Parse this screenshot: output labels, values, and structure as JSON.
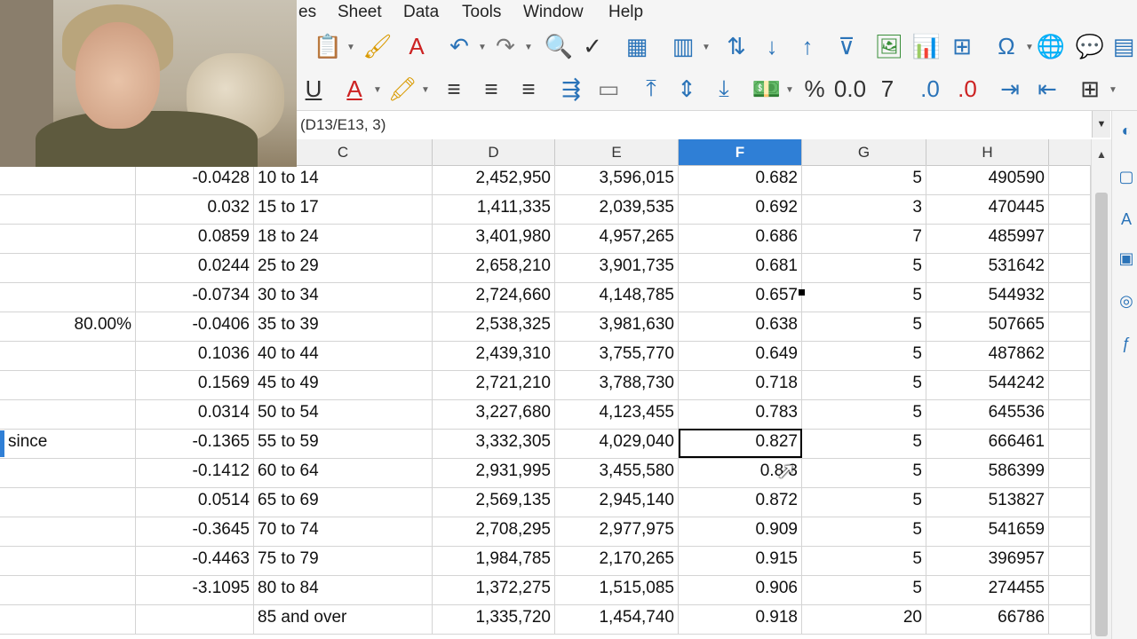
{
  "menu": {
    "items": [
      "es",
      "Sheet",
      "Data",
      "Tools",
      "Window",
      "Help"
    ]
  },
  "formula_bar": {
    "text": "(D13/E13, 3)"
  },
  "columns": [
    "C",
    "D",
    "E",
    "F",
    "G",
    "H"
  ],
  "selected_column": "F",
  "rows": [
    {
      "A": "",
      "B": "-0.0428",
      "C": "10 to 14",
      "D": "2,452,950",
      "E": "3,596,015",
      "F": "0.682",
      "G": "5",
      "H": "490590"
    },
    {
      "A": "",
      "B": "0.032",
      "C": "15 to 17",
      "D": "1,411,335",
      "E": "2,039,535",
      "F": "0.692",
      "G": "3",
      "H": "470445"
    },
    {
      "A": "",
      "B": "0.0859",
      "C": "18 to 24",
      "D": "3,401,980",
      "E": "4,957,265",
      "F": "0.686",
      "G": "7",
      "H": "485997"
    },
    {
      "A": "",
      "B": "0.0244",
      "C": "25 to 29",
      "D": "2,658,210",
      "E": "3,901,735",
      "F": "0.681",
      "G": "5",
      "H": "531642"
    },
    {
      "A": "",
      "B": "-0.0734",
      "C": "30 to 34",
      "D": "2,724,660",
      "E": "4,148,785",
      "F": "0.657",
      "G": "5",
      "H": "544932"
    },
    {
      "A": "80.00%",
      "B": "-0.0406",
      "C": "35 to 39",
      "D": "2,538,325",
      "E": "3,981,630",
      "F": "0.638",
      "G": "5",
      "H": "507665"
    },
    {
      "A": "",
      "B": "0.1036",
      "C": "40 to 44",
      "D": "2,439,310",
      "E": "3,755,770",
      "F": "0.649",
      "G": "5",
      "H": "487862"
    },
    {
      "A": "",
      "B": "0.1569",
      "C": "45 to 49",
      "D": "2,721,210",
      "E": "3,788,730",
      "F": "0.718",
      "G": "5",
      "H": "544242"
    },
    {
      "A": "",
      "B": "0.0314",
      "C": "50 to 54",
      "D": "3,227,680",
      "E": "4,123,455",
      "F": "0.783",
      "G": "5",
      "H": "645536"
    },
    {
      "A": "since",
      "B": "-0.1365",
      "C": "55 to 59",
      "D": "3,332,305",
      "E": "4,029,040",
      "F": "0.827",
      "G": "5",
      "H": "666461"
    },
    {
      "A": "",
      "B": "-0.1412",
      "C": "60 to 64",
      "D": "2,931,995",
      "E": "3,455,580",
      "F": "0.8 3",
      "G": "5",
      "H": "586399"
    },
    {
      "A": "",
      "B": "0.0514",
      "C": "65 to 69",
      "D": "2,569,135",
      "E": "2,945,140",
      "F": "0.872",
      "G": "5",
      "H": "513827"
    },
    {
      "A": "",
      "B": "-0.3645",
      "C": "70 to 74",
      "D": "2,708,295",
      "E": "2,977,975",
      "F": "0.909",
      "G": "5",
      "H": "541659"
    },
    {
      "A": "",
      "B": "-0.4463",
      "C": "75 to 79",
      "D": "1,984,785",
      "E": "2,170,265",
      "F": "0.915",
      "G": "5",
      "H": "396957"
    },
    {
      "A": "",
      "B": "-3.1095",
      "C": "80 to 84",
      "D": "1,372,275",
      "E": "1,515,085",
      "F": "0.906",
      "G": "5",
      "H": "274455"
    },
    {
      "A": "",
      "B": "",
      "C": "85 and over",
      "D": "1,335,720",
      "E": "1,454,740",
      "F": "0.918",
      "G": "20",
      "H": "66786"
    }
  ],
  "toolbar_icons": {
    "accent": "#2a73b8",
    "selection": "#2f7fd6"
  }
}
